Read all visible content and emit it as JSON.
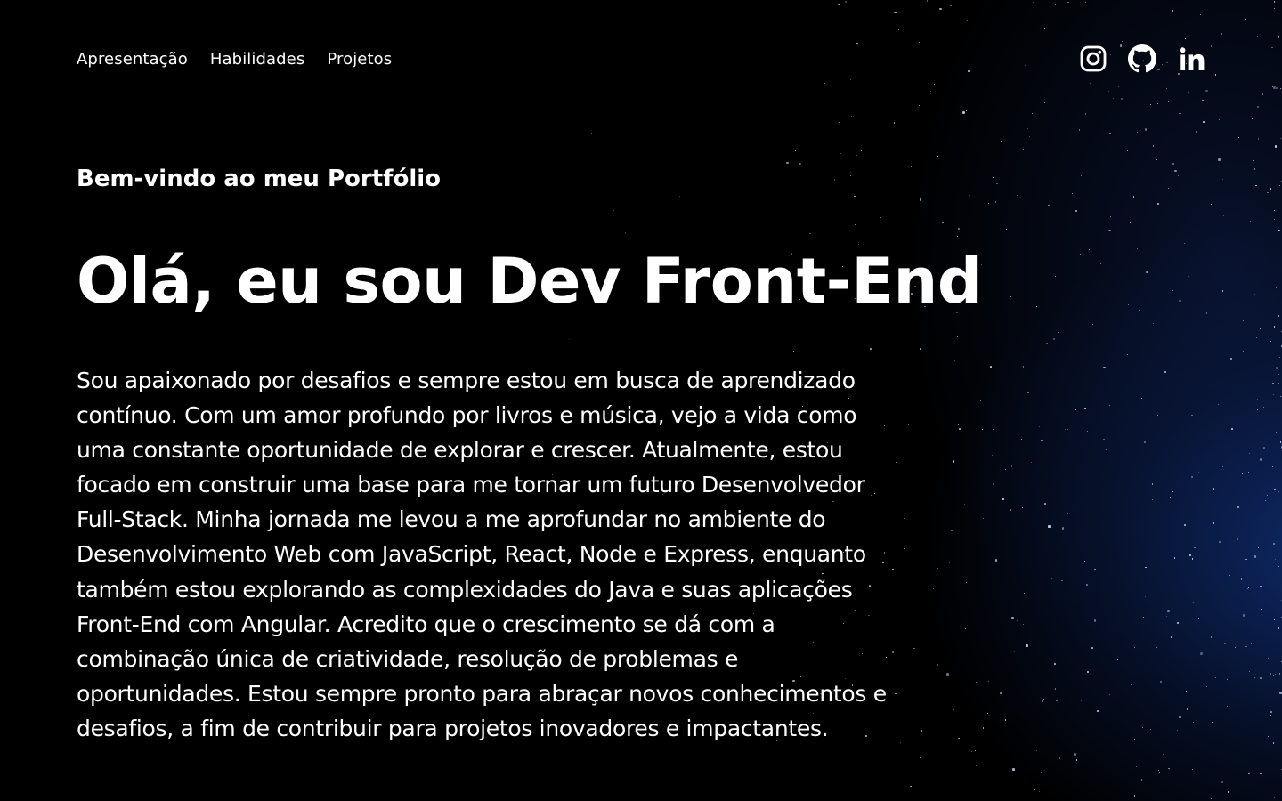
{
  "nav": {
    "items": [
      {
        "label": "Apresentação"
      },
      {
        "label": "Habilidades"
      },
      {
        "label": "Projetos"
      }
    ]
  },
  "socials": [
    {
      "icon": "instagram-icon"
    },
    {
      "icon": "github-icon"
    },
    {
      "icon": "linkedin-icon"
    }
  ],
  "hero": {
    "welcome": "Bem-vindo ao meu Portfólio",
    "headline": "Olá, eu sou Dev Front-End",
    "intro": "Sou apaixonado por desafios e sempre estou em busca de aprendizado contínuo. Com um amor profundo por livros e música, vejo a vida como uma constante oportunidade de explorar e crescer. Atualmente, estou focado em construir uma base para me tornar um futuro Desenvolvedor Full-Stack. Minha jornada me levou a me aprofundar no ambiente do Desenvolvimento Web com JavaScript, React, Node e Express, enquanto também estou explorando as complexidades do Java e suas aplicações Front-End com Angular. Acredito que o crescimento se dá com a combinação única de criatividade, resolução de problemas e oportunidades. Estou sempre pronto para abraçar novos conhecimentos e desafios, a fim de contribuir para projetos inovadores e impactantes."
  },
  "colors": {
    "background": "#000000",
    "text": "#ffffff",
    "nebula": "#10307a"
  }
}
